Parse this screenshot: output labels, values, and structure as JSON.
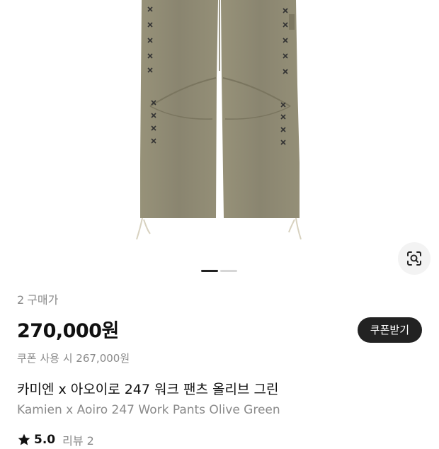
{
  "product": {
    "purchase_count": "2",
    "purchase_label": "구매가",
    "price": "270,000원",
    "coupon_button": "쿠폰받기",
    "coupon_price": "쿠폰 사용 시 267,000원",
    "title_ko": "카미엔 x 아오이로 247 워크 팬츠 올리브 그린",
    "title_en": "Kamien x Aoiro 247 Work Pants Olive Green",
    "rating": "5.0",
    "review_label": "리뷰 2"
  },
  "carousel": {
    "current": 1,
    "total": 2
  },
  "icons": {
    "lens": "image-search-icon",
    "star": "star-icon"
  },
  "colors": {
    "pants": "#8e8a70",
    "button": "#222222",
    "muted": "#8a8a8a"
  }
}
